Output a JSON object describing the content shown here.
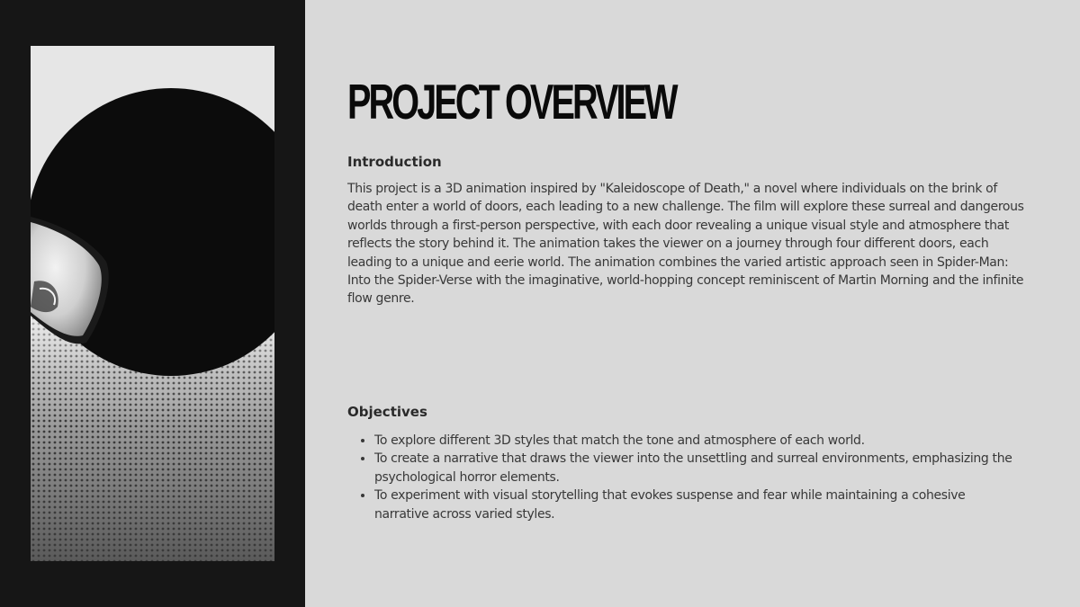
{
  "slide": {
    "title": "PROJECT OVERVIEW",
    "introduction": {
      "heading": "Introduction",
      "text": "This project is a 3D animation inspired by \"Kaleidoscope of Death,\" a novel where individuals on the brink of death enter a world of doors, each leading to a new challenge. The film will explore these surreal and dangerous worlds through a first-person perspective, with each door revealing a unique visual style and atmosphere that reflects the story behind it. The animation takes the viewer on a journey through four different doors, each leading to a unique and eerie world. The animation combines the varied artistic approach seen in Spider-Man: Into the Spider-Verse with the imaginative, world-hopping concept reminiscent of Martin Morning and the infinite flow genre."
    },
    "objectives": {
      "heading": "Objectives",
      "items": [
        "To explore different 3D styles that match the tone and atmosphere of each world.",
        "To create a narrative that draws the viewer into the unsettling and surreal environments, emphasizing the psychological horror elements.",
        "To experiment with visual storytelling that evokes suspense and fear while maintaining a cohesive narrative across varied styles."
      ]
    }
  },
  "colors": {
    "background": "#d9d9d9",
    "left_panel": "#161616",
    "title": "#0a0a0a",
    "body_text": "#383838"
  },
  "icons": {
    "artwork": "halftone-mask-illustration"
  }
}
